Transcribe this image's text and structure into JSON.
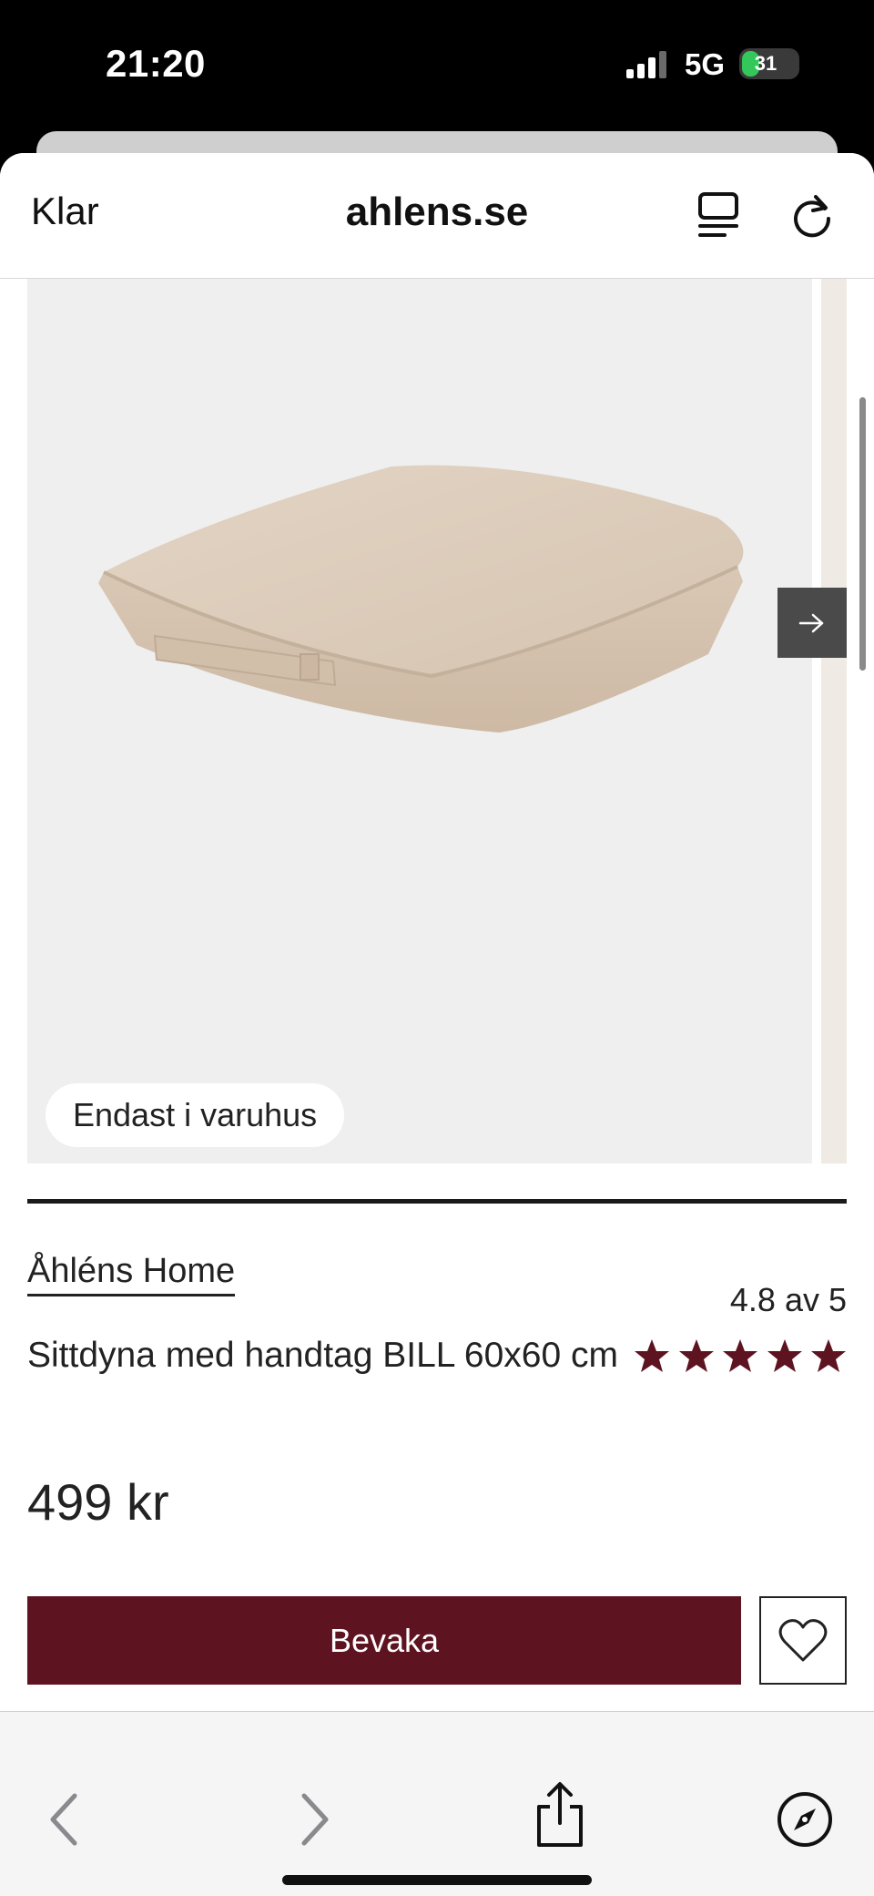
{
  "status_bar": {
    "time": "21:20",
    "network": "5G",
    "battery": "31",
    "battery_level": 0.31
  },
  "browser": {
    "done_label": "Klar",
    "domain": "ahlens.se"
  },
  "gallery": {
    "badge": "Endast i varuhus"
  },
  "product": {
    "brand": "Åhléns Home",
    "rating_text": "4.8 av 5",
    "stars": 5,
    "title": "Sittdyna med handtag BILL 60x60 cm",
    "price": "499 kr",
    "watch_button": "Bevaka"
  },
  "colors": {
    "accent": "#5e1320",
    "battery": "#34c759"
  },
  "icons": {
    "reader": "reader-mode-icon",
    "reload": "reload-icon",
    "next": "arrow-right-icon",
    "favorite": "heart-icon",
    "back": "chevron-left-icon",
    "forward": "chevron-right-icon",
    "share": "share-icon",
    "compass": "compass-icon"
  }
}
